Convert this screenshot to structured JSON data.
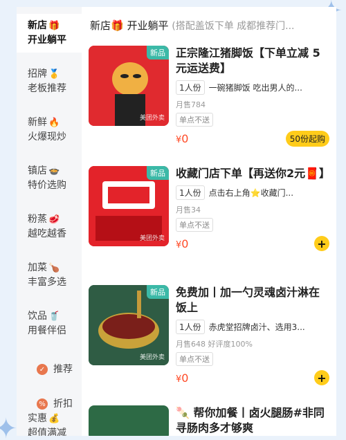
{
  "sidebar": {
    "items": [
      {
        "line1": "新店",
        "emoji": "🎁",
        "line2": "开业躺平",
        "active": true
      },
      {
        "line1": "招牌",
        "emoji": "🥇",
        "line2": "老板推荐"
      },
      {
        "line1": "新鲜",
        "emoji": "🔥",
        "line2": "火爆现炒"
      },
      {
        "line1": "镇店",
        "emoji": "🍲",
        "line2": "特价选购"
      },
      {
        "line1": "粉蒸",
        "emoji": "🥩",
        "line2": "越吃越香"
      },
      {
        "line1": "加菜",
        "emoji": "🍗",
        "line2": "丰富多选"
      },
      {
        "line1": "饮品",
        "emoji": "🥤",
        "line2": "用餐伴侣"
      },
      {
        "single": "推荐",
        "icon": "thumb"
      },
      {
        "single": "折扣",
        "icon": "discount"
      },
      {
        "line1": "实惠",
        "emoji": "💰",
        "line2": "超值满减"
      }
    ]
  },
  "header": {
    "title": "新店🎁 开业躺平",
    "sub": "(搭配盖饭下单 成都推荐门..."
  },
  "products": [
    {
      "title": "正宗隆江猪脚饭【下单立减 5元运送费】",
      "portion": "1人份",
      "desc": "一碗猪脚饭 吃出男人的...",
      "sales": "月售784",
      "no_delivery": "单点不送",
      "price_symbol": "¥",
      "price": "0",
      "badge": "新品",
      "min_order": "50份起购",
      "watermark": "美团外卖"
    },
    {
      "title": "收藏门店下单【再送你2元🧧】",
      "portion": "1人份",
      "desc": "点击右上角⭐收藏门...",
      "sales": "月售34",
      "no_delivery": "单点不送",
      "price_symbol": "¥",
      "price": "0",
      "badge": "新品",
      "add": "+",
      "watermark": "美团外卖"
    },
    {
      "title": "免费加丨加一勺灵魂卤汁淋在饭上",
      "portion": "1人份",
      "desc": "赤虎堂招牌卤汁、选用3...",
      "sales": "月售648 好评度100%",
      "no_delivery": "单点不送",
      "price_symbol": "¥",
      "price": "0",
      "badge": "新品",
      "add": "+",
      "watermark": "美团外卖"
    },
    {
      "title": "🍡 帮你加餐丨卤火腿肠#非同寻肠肉多才够爽"
    }
  ],
  "colors": {
    "accent": "#ffcc1a",
    "price": "#ff4a26",
    "badge": "#3bb9a7"
  }
}
